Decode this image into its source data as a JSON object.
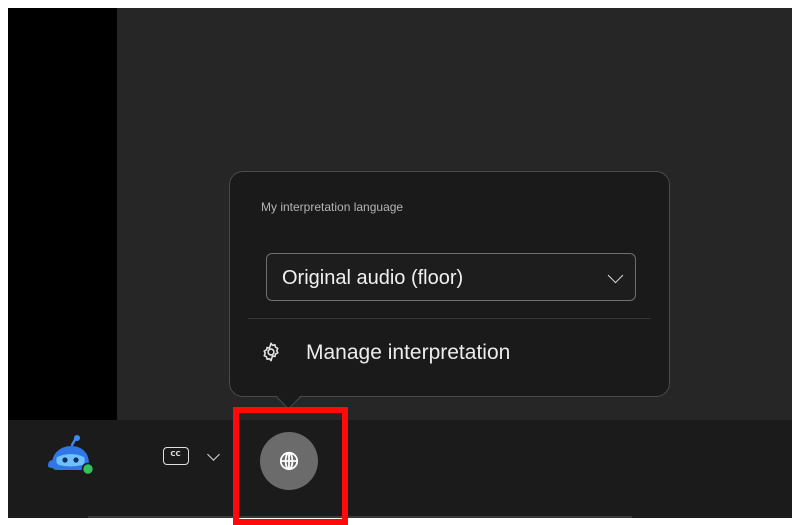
{
  "interpretation_popover": {
    "title": "My interpretation language",
    "selected_language": "Original audio (floor)",
    "manage_label": "Manage interpretation"
  },
  "toolbar": {
    "captions_badge": "CC"
  },
  "icons": {
    "assistant": "assistant-bot-icon",
    "captions": "closed-captions-icon",
    "interpretation": "globe-icon",
    "manage": "gear-icon"
  },
  "colors": {
    "highlight": "#ff0a0a",
    "bot_blue": "#3e8bf0",
    "status_green": "#33c15a",
    "interp_button_bg": "#6b6b6b"
  }
}
